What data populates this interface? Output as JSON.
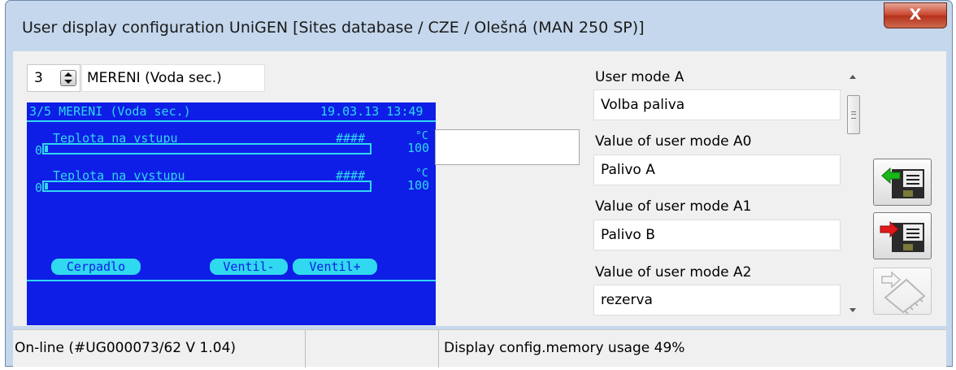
{
  "window": {
    "title": "User display configuration UniGEN [Sites database / CZE / Olešná (MAN 250 SP)]",
    "close_label": "X"
  },
  "screen_selector": {
    "number": "3",
    "name": "MERENI (Voda sec.)"
  },
  "lcd": {
    "header_left": "3/5 MERENI (Voda sec.)",
    "header_right": "19.03.13 13:49",
    "gauges": [
      {
        "label": "Teplota na vstupu",
        "value": "####",
        "unit": "°C",
        "min": "0",
        "max": "100",
        "level": 0.01
      },
      {
        "label": "Teplota na vystupu",
        "value": "####",
        "unit": "°C",
        "min": "0",
        "max": "100",
        "level": 0.01
      }
    ],
    "buttons": [
      "Cerpadlo",
      "Ventil-",
      "Ventil+"
    ],
    "colors": {
      "background": "#0e1ee6",
      "foreground": "#30d8f0"
    }
  },
  "middle_field": {
    "value": ""
  },
  "user_modes": {
    "mode_label": "User mode A",
    "mode_value": "Volba paliva",
    "values": [
      {
        "label": "Value of user mode A0",
        "value": "Palivo A"
      },
      {
        "label": "Value of user mode A1",
        "value": "Palivo B"
      },
      {
        "label": "Value of user mode A2",
        "value": "rezerva"
      }
    ]
  },
  "side_buttons": [
    {
      "icon": "import-config-icon"
    },
    {
      "icon": "export-config-icon"
    },
    {
      "icon": "controller-chip-icon",
      "disabled": true
    }
  ],
  "status": {
    "connection": "On-line (#UG000073/62  V 1.04)",
    "memory": "Display config.memory usage 49%"
  }
}
